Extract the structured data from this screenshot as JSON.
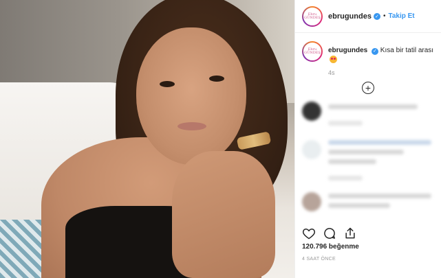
{
  "post": {
    "username": "ebrugundes",
    "verified_glyph": "✓",
    "separator": "•",
    "follow_label": "Takip Et",
    "avatar_text_line1": "Ebru",
    "avatar_text_line2": "GÜNDEŞ",
    "caption_text": "Kısa bir tatil arası",
    "caption_emoji": "heart-eyes-emoji",
    "caption_time": "4s",
    "load_more_glyph": "+",
    "likes": "120.796 beğenme",
    "posted_ago": "4 SAAT ÖNCE"
  },
  "icons": {
    "like": "heart-icon",
    "comment": "comment-icon",
    "share": "share-icon",
    "load_more": "plus-circle-icon"
  },
  "colors": {
    "link_blue": "#3897f0",
    "text": "#262626",
    "muted": "#999999"
  }
}
